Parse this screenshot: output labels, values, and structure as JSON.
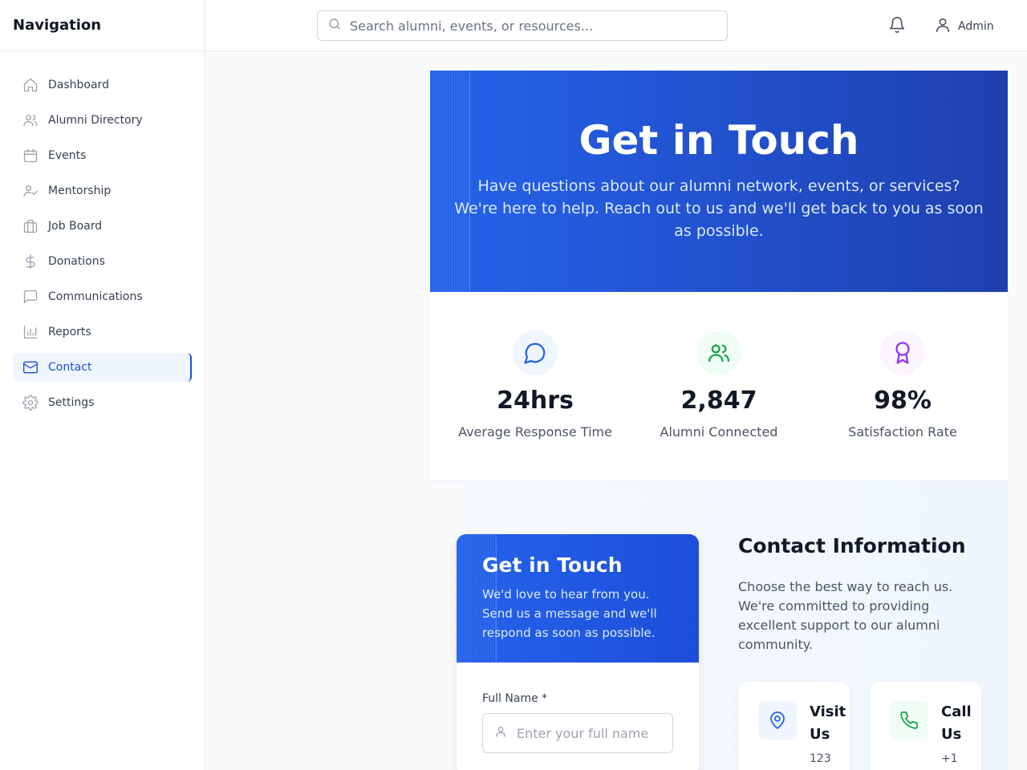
{
  "sidebar": {
    "title": "Navigation",
    "items": [
      {
        "label": "Dashboard",
        "icon": "home-icon"
      },
      {
        "label": "Alumni Directory",
        "icon": "users-icon"
      },
      {
        "label": "Events",
        "icon": "calendar-icon"
      },
      {
        "label": "Mentorship",
        "icon": "user-check-icon"
      },
      {
        "label": "Job Board",
        "icon": "briefcase-icon"
      },
      {
        "label": "Donations",
        "icon": "dollar-icon"
      },
      {
        "label": "Communications",
        "icon": "message-icon"
      },
      {
        "label": "Reports",
        "icon": "bar-chart-icon"
      },
      {
        "label": "Contact",
        "icon": "mail-icon",
        "active": true
      },
      {
        "label": "Settings",
        "icon": "gear-icon"
      }
    ]
  },
  "topbar": {
    "search_placeholder": "Search alumni, events, or resources...",
    "user_name": "Admin"
  },
  "hero": {
    "title": "Get in Touch",
    "subtitle": "Have questions about our alumni network, events, or services? We're here to help. Reach out to us and we'll get back to you as soon as possible."
  },
  "stats": [
    {
      "value": "24hrs",
      "label": "Average Response Time",
      "icon": "message-circle-icon",
      "color": "#2563eb",
      "bg": "#eff6ff"
    },
    {
      "value": "2,847",
      "label": "Alumni Connected",
      "icon": "users-icon",
      "color": "#16a34a",
      "bg": "#f0fdf4"
    },
    {
      "value": "98%",
      "label": "Satisfaction Rate",
      "icon": "award-icon",
      "color": "#9333ea",
      "bg": "#faf5ff"
    }
  ],
  "form": {
    "title": "Get in Touch",
    "subtitle": "We'd love to hear from you. Send us a message and we'll respond as soon as possible.",
    "full_name_label": "Full Name *",
    "full_name_placeholder": "Enter your full name"
  },
  "contact_info": {
    "title": "Contact Information",
    "subtitle": "Choose the best way to reach us. We're committed to providing excellent support to our alumni community.",
    "cards": [
      {
        "title": "Visit Us",
        "text": "123",
        "icon": "map-pin-icon",
        "color": "#2563eb",
        "bg": "#eff6ff"
      },
      {
        "title": "Call Us",
        "text": "+1",
        "icon": "phone-icon",
        "color": "#16a34a",
        "bg": "#f0fdf4"
      }
    ]
  }
}
